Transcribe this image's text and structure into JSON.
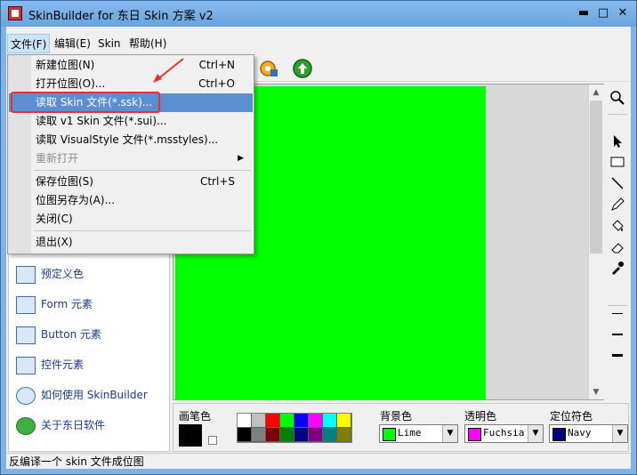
{
  "window": {
    "title": "SkinBuilder for 东日 Skin 方案 v2",
    "minimize_glyph": "▬",
    "maximize_glyph": "□",
    "close_glyph": "✕"
  },
  "menubar": {
    "file": "文件(F)",
    "edit": "编辑(E)",
    "skin": "Skin",
    "help": "帮助(H)"
  },
  "file_menu": {
    "items": [
      {
        "label": "新建位图(N)",
        "shortcut": "Ctrl+N"
      },
      {
        "label": "打开位图(O)...",
        "shortcut": "Ctrl+O"
      },
      {
        "label": "读取 Skin 文件(*.ssk)...",
        "shortcut": ""
      },
      {
        "label": "读取 v1 Skin 文件(*.sui)...",
        "shortcut": ""
      },
      {
        "label": "读取 VisualStyle 文件(*.msstyles)...",
        "shortcut": ""
      },
      {
        "label": "重新打开",
        "shortcut": ""
      },
      {
        "label": "保存位图(S)",
        "shortcut": "Ctrl+S"
      },
      {
        "label": "位图另存为(A)...",
        "shortcut": ""
      },
      {
        "label": "关闭(C)",
        "shortcut": ""
      },
      {
        "label": "退出(X)",
        "shortcut": ""
      }
    ],
    "submenu_arrow": "▶",
    "highlighted_index": 2
  },
  "left_panel": {
    "items": [
      {
        "label": "预定义色"
      },
      {
        "label": "Form 元素"
      },
      {
        "label": "Button 元素"
      },
      {
        "label": "控件元素"
      },
      {
        "label": "如何使用 SkinBuilder"
      },
      {
        "label": "关于东日软件"
      }
    ]
  },
  "canvas": {
    "color": "#00ff00"
  },
  "palette": {
    "pen_label": "画笔色",
    "bg_label": "背景色",
    "transparent_label": "透明色",
    "locator_label": "定位符色",
    "bg_value": "Lime",
    "transparent_value": "Fuchsia",
    "locator_value": "Navy",
    "bg_color": "#00ff00",
    "transparent_color": "#ff00ff",
    "locator_color": "#000080",
    "colors_row1": [
      "#ffffff",
      "#c0c0c0",
      "#ff0000",
      "#00ff00",
      "#0000ff",
      "#ff00ff",
      "#00ffff",
      "#ffff00"
    ],
    "colors_row2": [
      "#000000",
      "#808080",
      "#800000",
      "#008000",
      "#000080",
      "#800080",
      "#008080",
      "#808000"
    ]
  },
  "status": {
    "text": "反编译一个 skin 文件成位图"
  },
  "scroll": {
    "up": "▲",
    "down": "▼"
  }
}
